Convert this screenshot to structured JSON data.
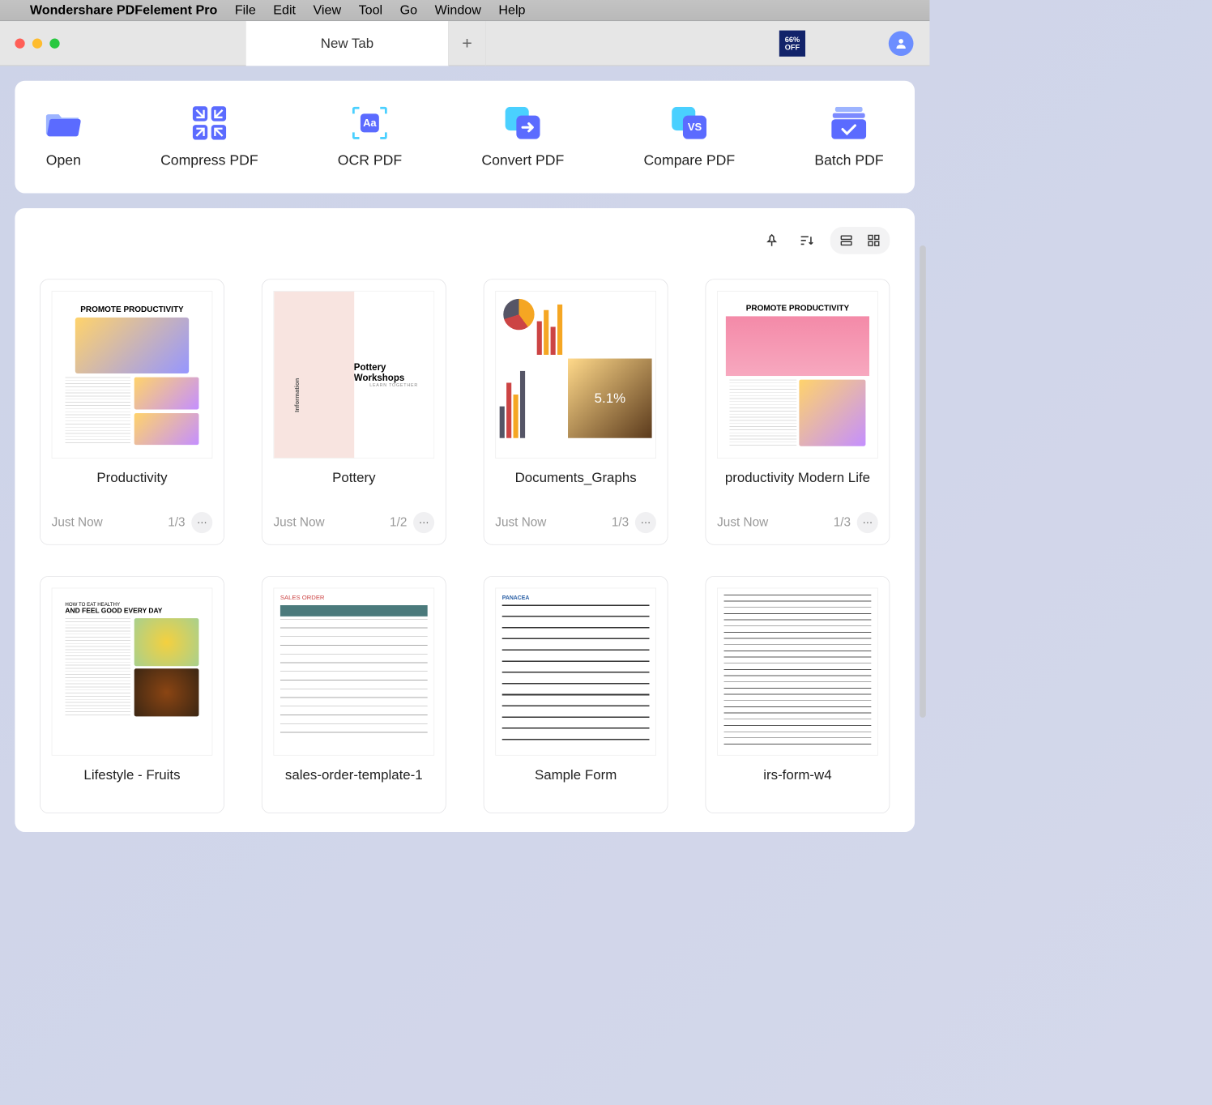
{
  "menubar": {
    "app_name": "Wondershare PDFelement Pro",
    "items": [
      "File",
      "Edit",
      "View",
      "Tool",
      "Go",
      "Window",
      "Help"
    ]
  },
  "tabbar": {
    "tab_label": "New Tab",
    "promo": "66% OFF"
  },
  "actions": [
    {
      "label": "Open"
    },
    {
      "label": "Compress PDF"
    },
    {
      "label": "OCR PDF"
    },
    {
      "label": "Convert PDF"
    },
    {
      "label": "Compare PDF"
    },
    {
      "label": "Batch PDF"
    }
  ],
  "files": [
    {
      "name": "Productivity",
      "time": "Just Now",
      "pages": "1/3",
      "thumb_title": "PROMOTE PRODUCTIVITY"
    },
    {
      "name": "Pottery",
      "time": "Just Now",
      "pages": "1/2",
      "thumb_title": "Pottery Workshops",
      "thumb_sub": "LEARN TOGETHER"
    },
    {
      "name": "Documents_Graphs",
      "time": "Just Now",
      "pages": "1/3",
      "percent": "5.1%"
    },
    {
      "name": "productivity Modern Life",
      "time": "Just Now",
      "pages": "1/3",
      "thumb_title": "PROMOTE PRODUCTIVITY"
    },
    {
      "name": "Lifestyle - Fruits",
      "time": "",
      "pages": "",
      "thumb_title": "HOW TO EAT HEALTHY",
      "thumb_sub": "AND FEEL GOOD EVERY DAY"
    },
    {
      "name": "sales-order-template-1",
      "time": "",
      "pages": "",
      "thumb_title": "SALES ORDER"
    },
    {
      "name": "Sample Form",
      "time": "",
      "pages": "",
      "thumb_title": "PANACEA"
    },
    {
      "name": "irs-form-w4",
      "time": "",
      "pages": ""
    }
  ]
}
